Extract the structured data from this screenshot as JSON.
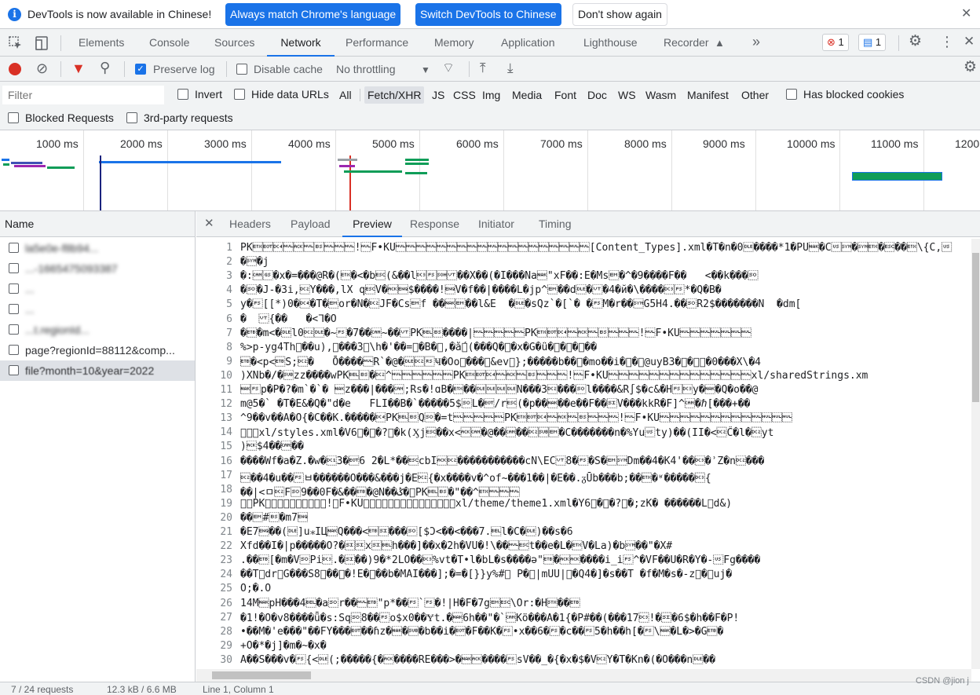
{
  "infobar": {
    "message": "DevTools is now available in Chinese!",
    "btn_match": "Always match Chrome's language",
    "btn_switch": "Switch DevTools to Chinese",
    "btn_dont": "Don't show again"
  },
  "tabs": [
    "Elements",
    "Console",
    "Sources",
    "Network",
    "Performance",
    "Memory",
    "Application",
    "Lighthouse",
    "Recorder"
  ],
  "active_tab": "Network",
  "more_tabs": "»",
  "errors_count": "1",
  "messages_count": "1",
  "toolbar": {
    "preserve_log": "Preserve log",
    "disable_cache": "Disable cache",
    "throttling": "No throttling"
  },
  "filter": {
    "placeholder": "Filter",
    "invert": "Invert",
    "hide_data_urls": "Hide data URLs",
    "types": [
      "All",
      "Fetch/XHR",
      "JS",
      "CSS",
      "Img",
      "Media",
      "Font",
      "Doc",
      "WS",
      "Wasm",
      "Manifest",
      "Other"
    ],
    "selected_type": "Fetch/XHR",
    "has_blocked": "Has blocked cookies",
    "blocked_requests": "Blocked Requests",
    "third_party": "3rd-party requests"
  },
  "timeline": {
    "ticks": [
      "1000 ms",
      "2000 ms",
      "3000 ms",
      "4000 ms",
      "5000 ms",
      "6000 ms",
      "7000 ms",
      "8000 ms",
      "9000 ms",
      "10000 ms",
      "11000 ms",
      "1200"
    ]
  },
  "requests": {
    "column_name": "Name",
    "rows": [
      "la5e0e-f8b94...",
      "...-1665475093387",
      "...",
      "...",
      "...t.regionId...",
      "page?regionId=88112&comp...",
      "file?month=10&year=2022"
    ],
    "status": "7 / 24 requests",
    "size": "12.3 kB / 6.6 MB"
  },
  "detail": {
    "tabs": [
      "Headers",
      "Payload",
      "Preview",
      "Response",
      "Initiator",
      "Timing"
    ],
    "active": "Preview",
    "status": "Line 1, Column 1",
    "lines": [
      "PK\u0003\u0004\u0014\u0000\u0006\u0000\b\u0000\u0000\u0000!\u0000F•KU\u0000\u0000\u0000\u0000\u0000\u0000\u0000\u0000\u0000\u0000\u0000\u0000\u0000\u0000\u0000\u0000\u0000\u0000\u0000[Content_Types].xml�T�n�0\u0010����*1�PU\u0015�C\u001f\u0016�\u0016\u0003�\u001b��\u0003\\{C,\u001f",
      "�\u0016�j",
      "�:\u0018\u001d�x�=���@R�(\u0003�<�b\u001b(&��l\u0013\u001c\u0001\u000b��X��(�I���Na\u0015\"xF��:E�Ms\u0019�^�9����F��   <��k���\u000e",
      "�\u000e�J-�3i,\u0012Y���,lX q\u001bV�\u0006\u0005$����!\u0005V�f��|����L�jp^\u0019��d\u0010�\u000b�4�й�\\����\u0013\u001c*�Q�B�",
      "y�\u001c[[*)0�\u0014�T�\u0019or�N�\u0012JF�Cs\u0019f ��\u0015\u0019��l&E  �\u0010�sQz`�[`� �\u001cM�r��\u0016G5H4.��\u000eR2$�������N  �dm[",
      "�  \u000b{��   �<ᒣ�O",
      "�\u0017�m<�\u0010l0\u0012\u0010�~\u001c�7��\u0018~��\u000bPK\u0007\b����|\u0000\u0000\u0000\u0000\u0000PK\u0003\u0004\u0014\u0000\u0006\u0000\b\u0000\u0000\u0000!\u0000F•KU\u0000\u0000\u0000\u0000\u0000\u0000\u0000",
      "%>p-yg4Th\u0000��u),\u0012���3\u0016\\h�'��=\u0012�B�\u0010,�ǻ\u0003(���Q�\u0019�x�G�ǘ�\u0017�\u0007�\u0012��",
      "\u0017�<p<\u0017S;\u0012�   Ō����\u0000R`�@�\u0010\u0012\u001eҸ�Oo\u0000���\u0014&ev\u0013};�����b��\u0018�mo��i�\u0013�\u0010@uyB3�\u0007�\u0003\u0004�0���X\\�4",
      ")XNb�/�\u001azz����wPK\u0007\b�\u0012^\u0000\u0000\u0000\u0000\u0000\u0000PK\u0003\u0004\u0014\u0000\u0006\u0000\b\u0000\u0000\u0000!\u0000F•KU\u0000\u0000\u0000\u0000\u0000\u0000\u0000\u0000\u0000\u0000\u0000\u0000\u0000\u0000xl/sharedStrings.xm",
      "\u0015\u001cp�P�?�m`�`� \u0015z���|���\u0018;Rs�!ɑB�\u0003��\u0010\u0010\u0010\u0010N���3\u0012���\u000el����&R∫$�c&�H\u001c\u0013y�\u0015�Q�o��@",
      "m@5�` �T�E&�Q�\"d�e   FLI��B�`�����5$\u000eL�\u0004/r\u001b(�p��\u0015��e��F��\u000fV���kkR�F]^\u0018�ℏ[���+��",
      "^9��v��A�O{�Č��K.�����\u0014PK\u0007\bQ\u000e�=t\u0000\u0000\u0000\u0000\u0000PK\u0003\u0004\u0014\u0000\u0006\u0000\b\u0000\u0000\u0000!\u0000F•KU\u0000\u0000\u0000\u0000\u0000\u0000\u0000\u0000\u0000\u0000\u0000\u0000\u0000",
      "\u0000\u0000\u0000xl/styles.xml�V͏6\u0014�\u0017�?\u000b�k(Ӽj\u001b��x<\u0006\u0018�@��\u0018��\u0012\u001a\u0019�C�������n�%Yu\u001fty)��(II�<\u0012Ĉ�l�\u0012yt",
      ")\u0006$4��\u0018��",
      "����Wf�a�Z.�w�\u00113�\u00046 2�L*��\u001bcbI\u0006\u0012�����������cN\\EC\u000b8�\u001c�S�\u0019\u0016Dm��4�K4'��\u0013�ʾZ�n\u0012���",
      "\u0012��4�u��\u001cㅂ������O���&���j�E\u0012{�x����v�^of~���1��|�E��.ᵹŪb���b;��\u0003�ʶ�����\u0013{",
      "��|<ㅁ\u0012F\u000e9��0F�&��\u0017�@N��ݣ�\u0000PK\u0007\b�\"��^\u0003\u0000\u0000\u0000",
      "\u0000\u0000PK\u0003\u0004\u0014\u0000\u0006\u0000\b\u0000\u0000\u0000!\u0000F•KU\u0000\u0000\u0000\u0000\u0000\u0000\u0000\u0000\u0000\u0000\u0000\u0000\u0000\u0000\u0000xl/theme/theme1.xml�Y͏6\u0014�\u0017�?\u0013�;zK� ������L\u0012d&)",
      "��\u0019#\b�m7\u0005",
      "�E7\u0005��(\u0010]u⁎IЦ\u0015Q���<\u0017\u000f���\u000e[$Ɔ<��<���7.\u0007l�C�\u0010)��s�6",
      "Xfd��I�|p�����O?�\u000f\u000fx\u000f\u0007h���]��x�2h�VU�!\\��\u0000\u001bt��e�L�\u0003V�La)�b\u0016��\"�X#",
      ".��\u0017[�m�V\u000ePi\u0013.�\u000f��)9�*2LO��\u0013%vt�T•l�bL�s����ǝ\"\u0017�\u0006\u0006����i_i\u001c^�VF��U�R�Y�-\u001fFg����",
      "��T\u0000dr\u000eG���S8\u0006��\u000e�!E�\u0011��b�MAI���];�=�[}}y%#\u0010 P�\u001a|mUU|\u001f�Q4�]�s��T �f�M�s�-z\u0005�\u0015uj�",
      "Ō;�.O",
      "14M\u0015pH���4\u0007�a\u000er��\u0000\u0017\"p*��\u001c`\u001c�!|H�F�7g\u0019\u001b\\Or:�H\u0002��\u0017",
      "�1!�O�v8����ǖ�s:Sq\u000e8��\u001co$x0��Ɏt.�\u00156h��\"�`\u0018Kö���A�1{�P#��(���17\u0013!�\u000f�6$�h��F�P!",
      "•��M�'e���\"��FY���\u0004��ɦz�\u0015�\u001a�b��i�\u0004�F��K�\u001c•x��6�\u001c�c��\u001c5�h��h[�\u001c\\\u0015�L�>�G\u0017�",
      "+O�*�j]�m�~�x�",
      "A��S���v�\u001c{<\u0010(;�����{�\u0006����RE���>�\u0015\u0006����\u001csV��_�{�x�$�V\u0012Y�T�Kn�(�O���n\u0010��"
    ]
  },
  "watermark": "CSDN @jion j"
}
